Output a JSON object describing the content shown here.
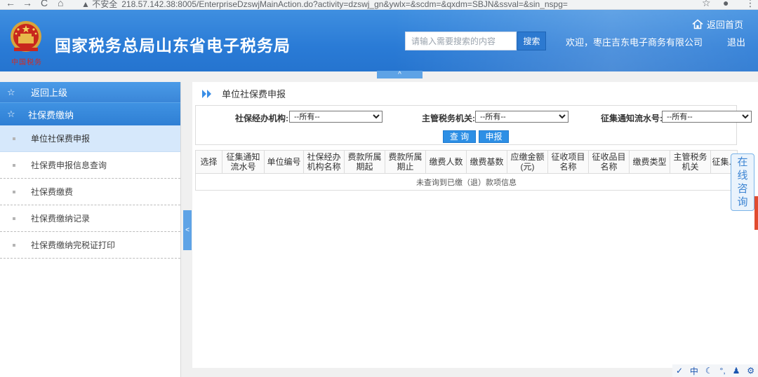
{
  "browser": {
    "back_glyph": "←",
    "forward_glyph": "→",
    "reload_glyph": "C",
    "home_glyph": "⌂",
    "security_label": "▲ 不安全",
    "url": "218.57.142.38:8005/EnterpriseDzswjMainAction.do?activity=dzswj_gn&ywlx=&scdm=&qxdm=SBJN&ssval=&sin_nspg=",
    "bookmark_glyph": "☆",
    "profile_glyph": "●",
    "menu_glyph": "⋮"
  },
  "header": {
    "emblem_caption": "中国税务",
    "title": "国家税务总局山东省电子税务局",
    "search_placeholder": "请输入需要搜索的内容",
    "search_button": "搜索",
    "welcome": "欢迎，枣庄吉东电子商务有限公司",
    "logout": "退出",
    "home": "返回首页",
    "collapse_glyph": "^"
  },
  "sidebar": {
    "back": "返回上级",
    "group": "社保费缴纳",
    "items": [
      {
        "label": "单位社保费申报"
      },
      {
        "label": "社保费申报信息查询"
      },
      {
        "label": "社保费缴费"
      },
      {
        "label": "社保费缴纳记录"
      },
      {
        "label": "社保费缴纳完税证打印"
      }
    ],
    "collapse_glyph": "<"
  },
  "main": {
    "breadcrumb": "单位社保费申报",
    "filters": {
      "agency_label": "社保经办机构:",
      "agency_value": "--所有--",
      "tax_org_label": "主管税务机关:",
      "tax_org_value": "--所有--",
      "notice_label": "征集通知流水号:",
      "notice_value": "--所有--"
    },
    "buttons": {
      "query": "查 询",
      "declare": "申报"
    },
    "table": {
      "headers": [
        "选择",
        "征集通知流水号",
        "单位编号",
        "社保经办机构名称",
        "费款所属期起",
        "费款所属期止",
        "缴费人数",
        "缴费基数",
        "应缴金额(元)",
        "征收项目名称",
        "征收品目名称",
        "缴费类型",
        "主管税务机关",
        "征集..."
      ],
      "empty_message": "未查询到已缴（退）款项信息"
    }
  },
  "consult": {
    "label": "在线咨询"
  },
  "tray": {
    "icons": [
      "✓",
      "中",
      "☾",
      "°,",
      "♟",
      "⚙"
    ]
  },
  "colors": {
    "header_blue": "#2a7bd6",
    "button_blue": "#2d8fe5",
    "active_item": "#d6e8fb"
  }
}
